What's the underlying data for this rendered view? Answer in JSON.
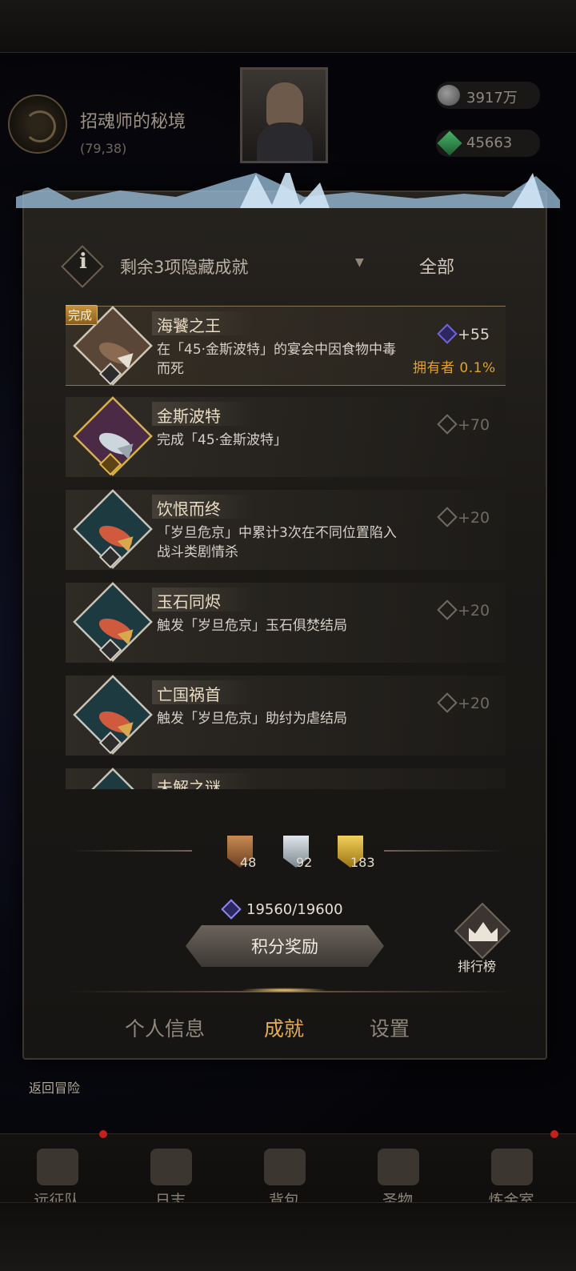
{
  "location": {
    "name": "招魂师的秘境",
    "coords": "(79,38)"
  },
  "resources": {
    "silver": "3917万",
    "gem": "45663"
  },
  "filter": {
    "label": "剩余3项隐藏成就",
    "option": "全部",
    "info_glyph": "i"
  },
  "achievements": [
    {
      "title": "海饕之王",
      "desc": "在「45·金斯波特」的宴会中因食物中毒而死",
      "points": "+55",
      "done_tag": "完成",
      "owner": "拥有者  0.1%"
    },
    {
      "title": "金斯波特",
      "desc": "完成「45·金斯波特」",
      "points": "+70"
    },
    {
      "title": "饮恨而终",
      "desc": "「岁旦危京」中累计3次在不同位置陷入战斗类剧情杀",
      "points": "+20"
    },
    {
      "title": "玉石同烬",
      "desc": "触发「岁旦危京」玉石俱焚结局",
      "points": "+20"
    },
    {
      "title": "亡国祸首",
      "desc": "触发「岁旦危京」助纣为虐结局",
      "points": "+20"
    },
    {
      "title": "未解之谜",
      "desc": "",
      "points": ""
    }
  ],
  "tiers": {
    "bronze": "48",
    "silver": "92",
    "gold": "183"
  },
  "score": "19560/19600",
  "reward_button": "积分奖励",
  "ranking_label": "排行榜",
  "tabs": {
    "profile": "个人信息",
    "achievements": "成就",
    "settings": "设置"
  },
  "return_label": "返回冒险",
  "bottom_nav": {
    "expedition": "远征队",
    "log": "日志",
    "bag": "背包",
    "relic": "圣物",
    "alchemy": "炼金室"
  },
  "colors": {
    "accent_gold": "#e2ac52",
    "owner_orange": "#e3a12a",
    "notification_red": "#c4211c"
  }
}
